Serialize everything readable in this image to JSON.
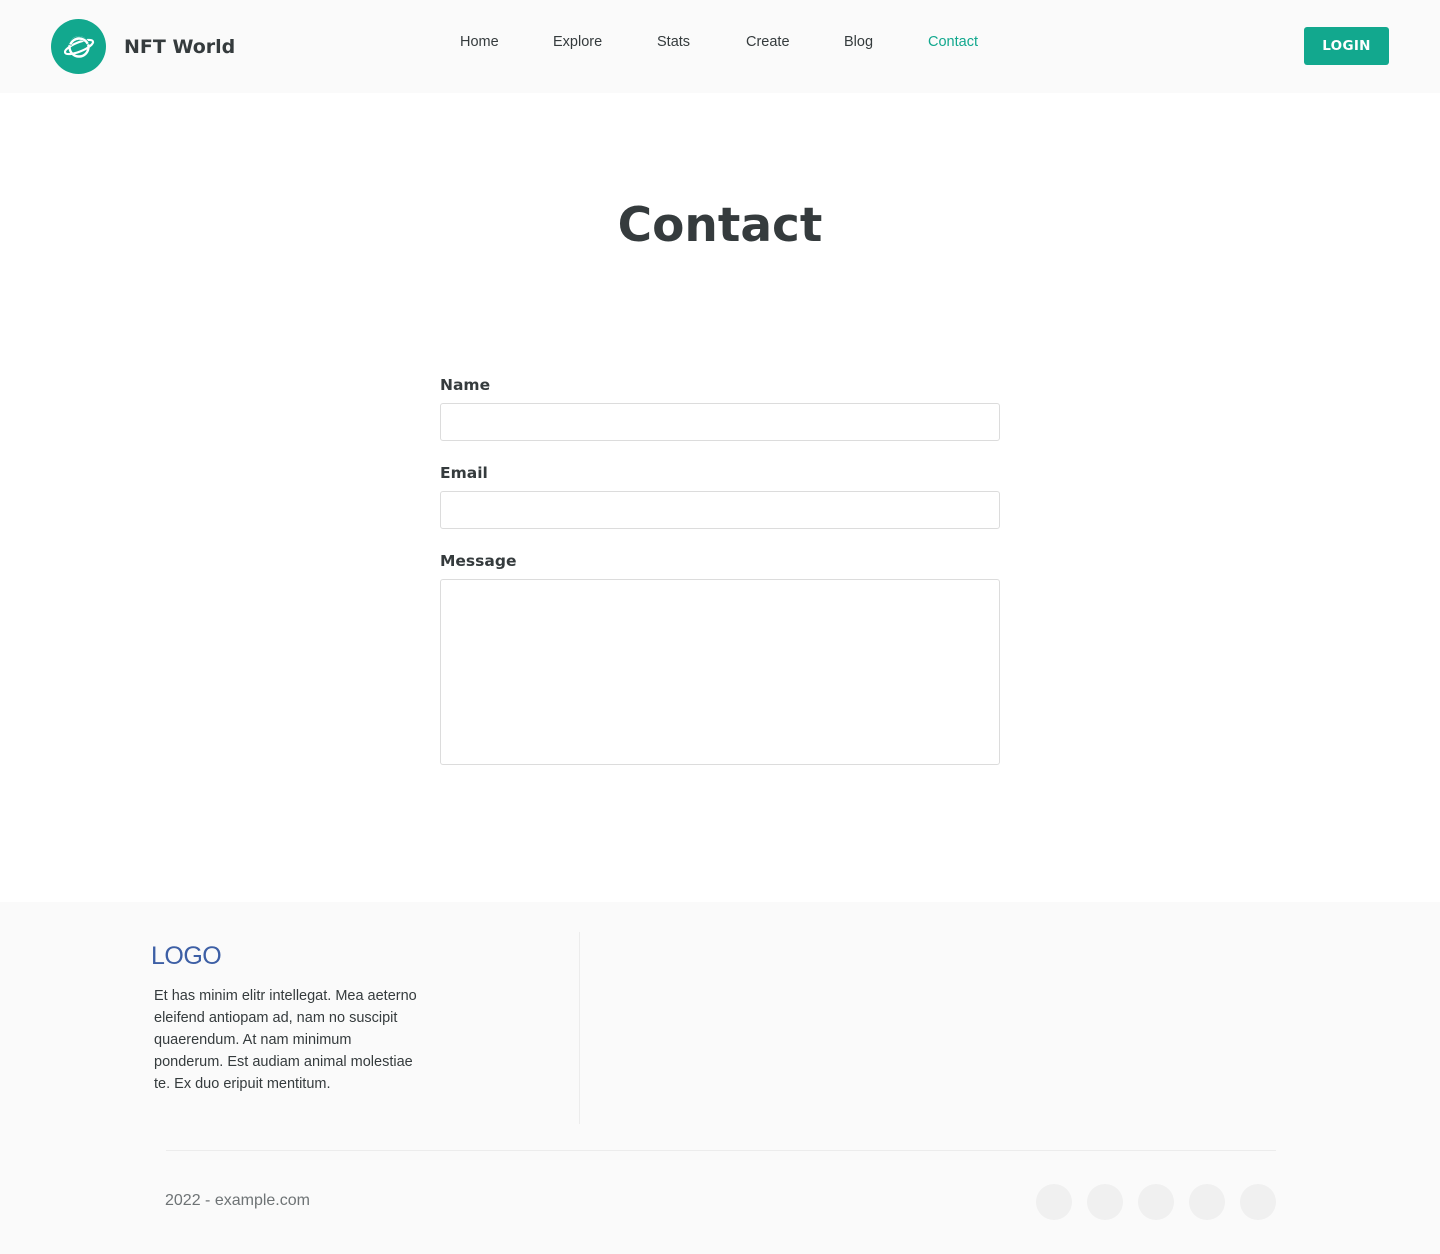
{
  "header": {
    "brand_name": "NFT World",
    "logo_icon": "planet-icon",
    "nav": [
      {
        "label": "Home",
        "active": false
      },
      {
        "label": "Explore",
        "active": false
      },
      {
        "label": "Stats",
        "active": false
      },
      {
        "label": "Create",
        "active": false
      },
      {
        "label": "Blog",
        "active": false
      },
      {
        "label": "Contact",
        "active": true
      }
    ],
    "login_label": "LOGIN"
  },
  "main": {
    "title": "Contact",
    "form": {
      "name_label": "Name",
      "name_value": "",
      "email_label": "Email",
      "email_value": "",
      "message_label": "Message",
      "message_value": ""
    }
  },
  "footer": {
    "logo": "LOGO",
    "text": "Et has minim elitr intellegat. Mea aeterno eleifend antiopam ad, nam no suscipit quaerendum. At nam minimum ponderum. Est audiam animal molestiae te. Ex duo eripuit mentitum.",
    "copyright": "2022 - example.com",
    "social_icons": [
      "social-icon-1",
      "social-icon-2",
      "social-icon-3",
      "social-icon-4",
      "social-icon-5"
    ]
  },
  "colors": {
    "accent": "#12a88e",
    "text": "#353b3d",
    "footer_logo": "#3d5fa5",
    "header_bg": "#fafafa"
  }
}
